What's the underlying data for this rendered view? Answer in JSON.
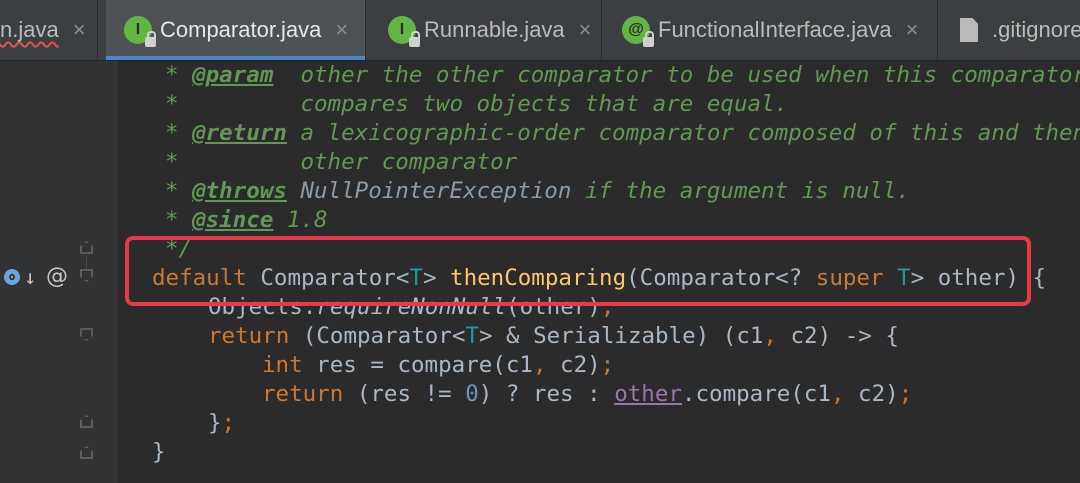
{
  "tabs": [
    {
      "label": "n.java",
      "badge": "",
      "close": "×"
    },
    {
      "label": "Comparator.java",
      "badge": "I",
      "close": "×"
    },
    {
      "label": "Runnable.java",
      "badge": "I",
      "close": "×"
    },
    {
      "label": "FunctionalInterface.java",
      "badge": "@",
      "close": "×"
    },
    {
      "label": ".gitignore",
      "badge": "",
      "close": ""
    }
  ],
  "gutter": {
    "override_badge": "o",
    "arrow": "↓",
    "annotation": "@"
  },
  "code": {
    "l1": {
      "star": "* ",
      "tag": "@param",
      "sp": "  ",
      "text": "other the other comparator to be used when this comparator"
    },
    "l2": {
      "text": "*         compares two objects that are equal."
    },
    "l3": {
      "star": "* ",
      "tag": "@return",
      "text": " a lexicographic-order comparator composed of this and then the"
    },
    "l4": {
      "text": "*         other comparator"
    },
    "l5": {
      "star": "* ",
      "tag": "@throws",
      "sp": " ",
      "ref": "NullPointerException",
      "text": " if the argument is null."
    },
    "l6": {
      "star": "* ",
      "tag": "@since",
      "text": " 1.8"
    },
    "l7": {
      "text": "*/"
    },
    "l8": {
      "kw_default": "default",
      "type1": " Comparator<",
      "t1": "T",
      "type2": "> ",
      "method": "thenComparing",
      "p1": "(Comparator<? ",
      "kw_super": "super",
      "p2": " ",
      "t2": "T",
      "p3": "> other) {"
    },
    "l9": {
      "obj": "Objects.",
      "call": "requireNonNull",
      "rest": "(other)",
      "semi": ";"
    },
    "l10": {
      "kw": "return",
      "a": " (Comparator<",
      "t": "T",
      "b": "> & Serializable) (c1",
      "comma": ",",
      "c": " c2) -> {"
    },
    "l11": {
      "kw": "int",
      "a": " res = compare(c1",
      "comma": ",",
      "b": " c2)",
      "semi": ";"
    },
    "l12": {
      "kw": "return",
      "a": " (res != ",
      "num": "0",
      "b": ") ? res : ",
      "field": "other",
      "c": ".compare(c1",
      "comma": ",",
      "d": " c2)",
      "semi": ";"
    },
    "l13": {
      "a": "}",
      "semi": ";"
    },
    "l14": {
      "a": "}"
    }
  }
}
